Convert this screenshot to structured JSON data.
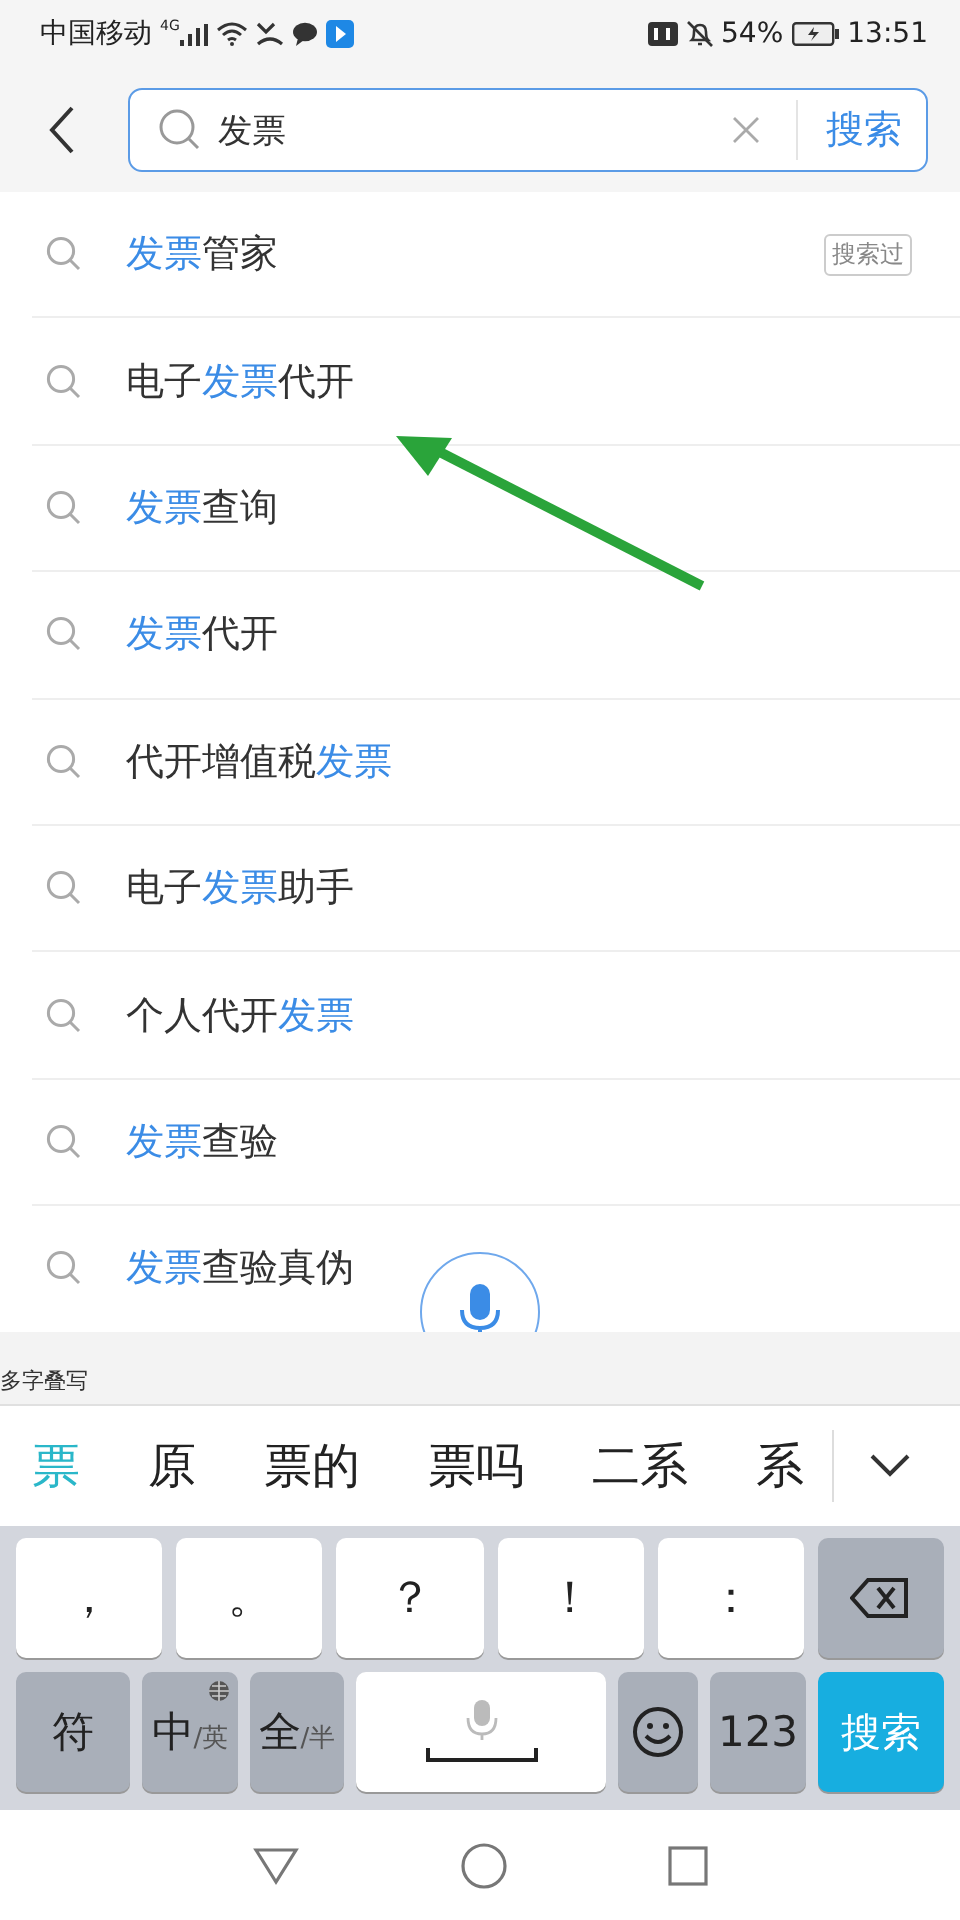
{
  "status_bar": {
    "carrier": "中国移动",
    "network": "4G",
    "battery": "54%",
    "time": "13:51"
  },
  "search": {
    "value": "发票",
    "submit": "搜索"
  },
  "suggestions": [
    {
      "parts": [
        {
          "text": "发票",
          "highlight": true
        },
        {
          "text": "管家",
          "highlight": false
        }
      ],
      "tag": "搜索过"
    },
    {
      "parts": [
        {
          "text": "电子",
          "highlight": false
        },
        {
          "text": "发票",
          "highlight": true
        },
        {
          "text": "代开",
          "highlight": false
        }
      ]
    },
    {
      "parts": [
        {
          "text": "发票",
          "highlight": true
        },
        {
          "text": "查询",
          "highlight": false
        }
      ]
    },
    {
      "parts": [
        {
          "text": "发票",
          "highlight": true
        },
        {
          "text": "代开",
          "highlight": false
        }
      ]
    },
    {
      "parts": [
        {
          "text": "代开增值税",
          "highlight": false
        },
        {
          "text": "发票",
          "highlight": true
        }
      ]
    },
    {
      "parts": [
        {
          "text": "电子",
          "highlight": false
        },
        {
          "text": "发票",
          "highlight": true
        },
        {
          "text": "助手",
          "highlight": false
        }
      ]
    },
    {
      "parts": [
        {
          "text": "个人代开",
          "highlight": false
        },
        {
          "text": "发票",
          "highlight": true
        }
      ]
    },
    {
      "parts": [
        {
          "text": "发票",
          "highlight": true
        },
        {
          "text": "查验",
          "highlight": false
        }
      ]
    },
    {
      "parts": [
        {
          "text": "发票",
          "highlight": true
        },
        {
          "text": "查验真伪",
          "highlight": false
        }
      ]
    }
  ],
  "annotation": {
    "kind": "arrow"
  },
  "keyboard": {
    "mode_label": "多字叠写",
    "candidates": [
      {
        "text": "票",
        "selected": true
      },
      {
        "text": "原",
        "selected": false
      },
      {
        "text": "票的",
        "selected": false
      },
      {
        "text": "票吗",
        "selected": false
      },
      {
        "text": "二系",
        "selected": false
      },
      {
        "text": "系",
        "selected": false
      }
    ],
    "rows": [
      [
        {
          "kind": "char",
          "label": "，"
        },
        {
          "kind": "char",
          "label": "。"
        },
        {
          "kind": "char",
          "label": "？"
        },
        {
          "kind": "char",
          "label": "！"
        },
        {
          "kind": "char",
          "label": "："
        },
        {
          "kind": "backspace"
        }
      ],
      [
        {
          "kind": "mod",
          "label": "符"
        },
        {
          "kind": "mod",
          "label": "中",
          "sub": "/英",
          "globe": true
        },
        {
          "kind": "mod",
          "label": "全",
          "sub": "/半"
        },
        {
          "kind": "space"
        },
        {
          "kind": "emoji"
        },
        {
          "kind": "mod",
          "label": "123"
        },
        {
          "kind": "action",
          "label": "搜索"
        }
      ]
    ]
  }
}
